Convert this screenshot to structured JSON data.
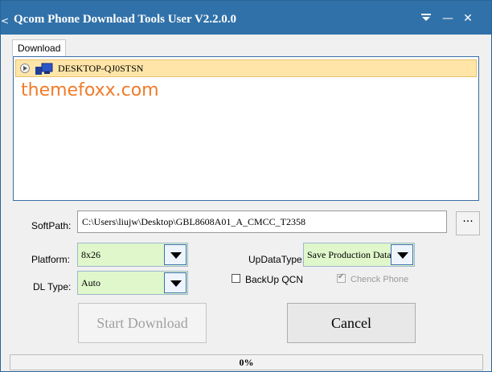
{
  "window": {
    "title": "Qcom Phone Download Tools User V2.2.0.0",
    "left_edge_glyph": "<",
    "accent_color": "#3071a9"
  },
  "titlebar_buttons": {
    "menu_icon": "menu-down-icon",
    "minimize": "—",
    "close": "✕"
  },
  "tabs": [
    {
      "label": "Download"
    }
  ],
  "devices": [
    {
      "name": "DESKTOP-QJ0STSN",
      "icon": "computer-icon"
    }
  ],
  "watermark": "themefoxx.com",
  "softpath": {
    "label": "SoftPath:",
    "value": "C:\\Users\\liujw\\Desktop\\GBL8608A01_A_CMCC_T2358",
    "browse_label": "···"
  },
  "platform": {
    "label": "Platform:",
    "value": "8x26"
  },
  "dl_type": {
    "label": "DL Type:",
    "value": "Auto"
  },
  "updata_type": {
    "label": "UpDataType:",
    "value": "Save Production Data"
  },
  "options": {
    "backup_qcn": {
      "label": "BackUp QCN",
      "checked": false
    },
    "check_phone": {
      "label": "Chenck Phone",
      "checked": true,
      "disabled": true
    }
  },
  "buttons": {
    "start": "Start Download",
    "cancel": "Cancel"
  },
  "progress": {
    "value": 0,
    "text": "0%"
  }
}
